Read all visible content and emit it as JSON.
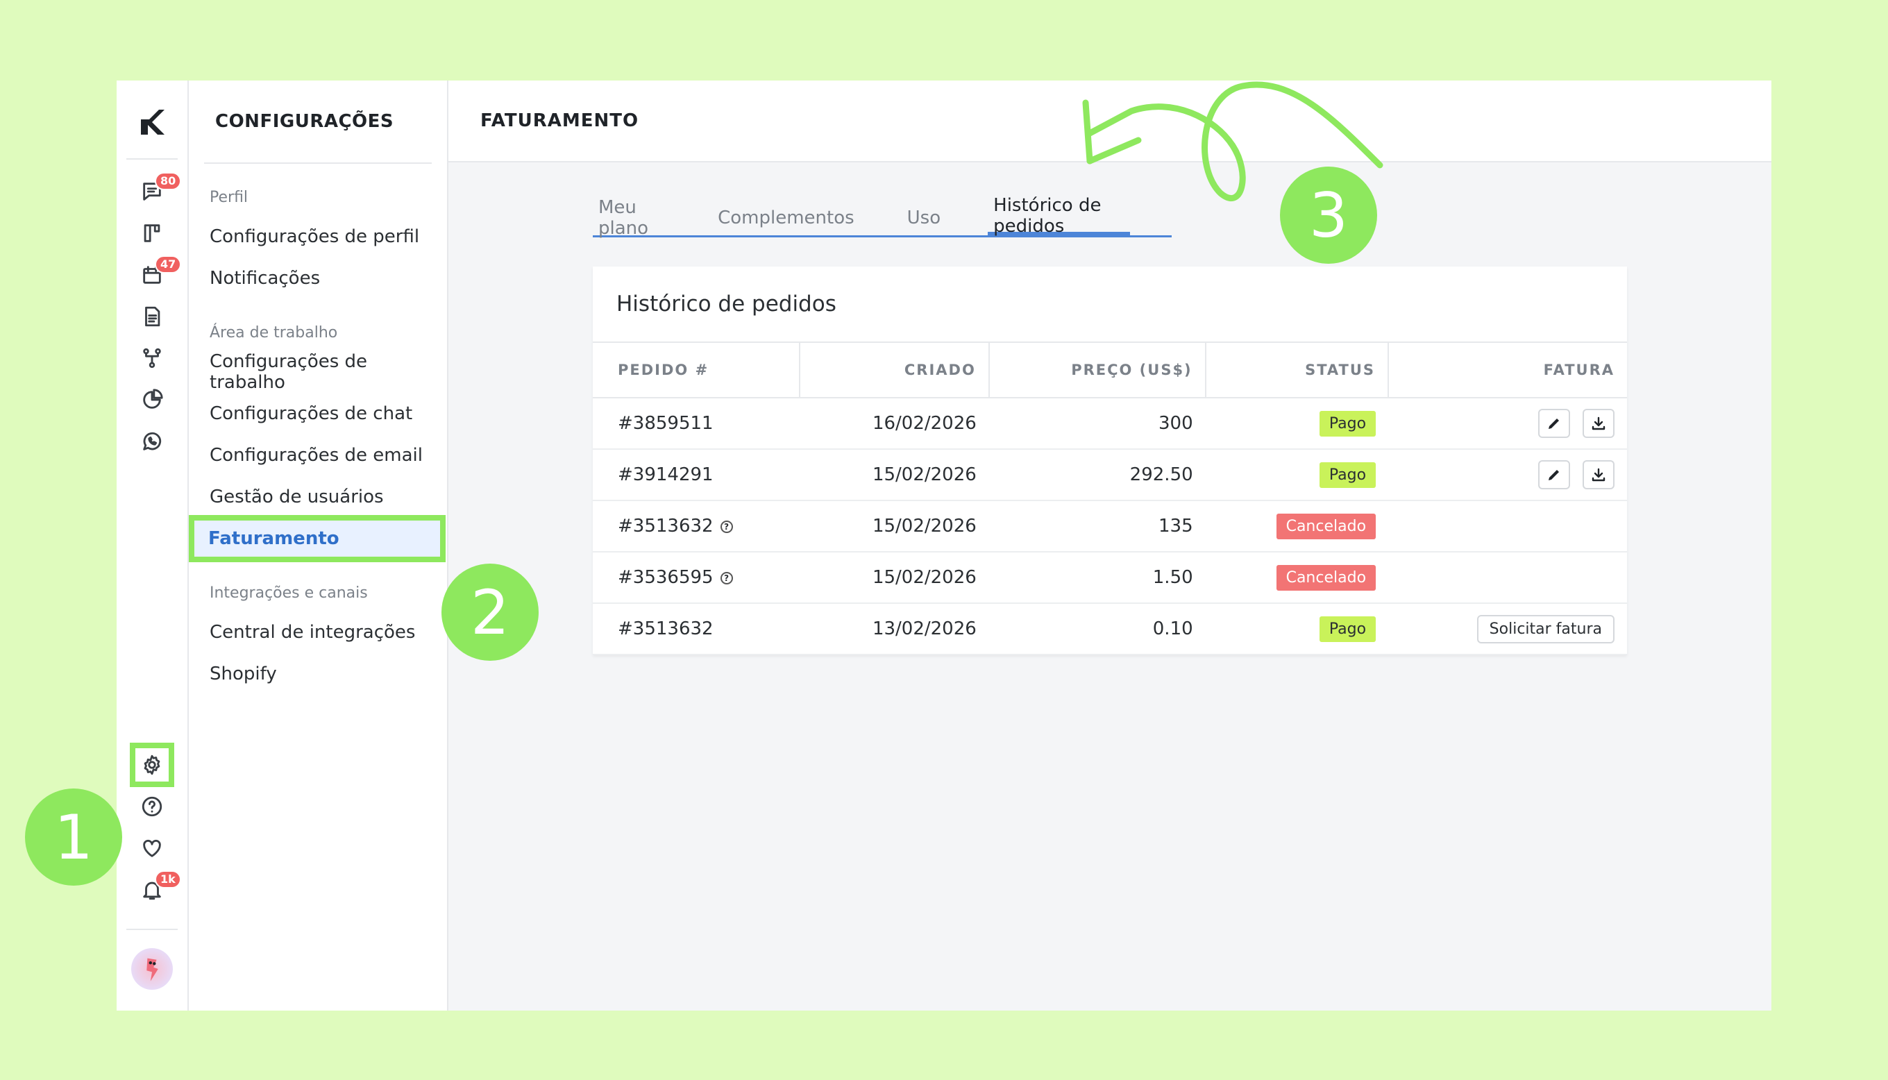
{
  "rail": {
    "badges": {
      "chat": "80",
      "calendar": "47",
      "notifications": "1k"
    }
  },
  "menu": {
    "title": "CONFIGURAÇÕES",
    "groups": [
      {
        "label": "Perfil",
        "items": [
          "Configurações de perfil",
          "Notificações"
        ]
      },
      {
        "label": "Área de trabalho",
        "items": [
          "Configurações de trabalho",
          "Configurações de chat",
          "Configurações de email",
          "Gestão de usuários",
          "Faturamento"
        ]
      },
      {
        "label": "Integrações e canais",
        "items": [
          "Central de integrações",
          "Shopify"
        ]
      }
    ]
  },
  "main": {
    "title": "FATURAMENTO",
    "tabs": [
      "Meu plano",
      "Complementos",
      "Uso",
      "Histórico de pedidos"
    ],
    "card_title": "Histórico de pedidos",
    "columns": [
      "PEDIDO #",
      "CRIADO",
      "PREÇO (US$)",
      "STATUS",
      "FATURA"
    ],
    "rows": [
      {
        "order": "#3859511",
        "created": "16/02/2026",
        "price": "300",
        "status": "Pago"
      },
      {
        "order": "#3914291",
        "created": "15/02/2026",
        "price": "292.50",
        "status": "Pago"
      },
      {
        "order": "#3513632",
        "created": "15/02/2026",
        "price": "135",
        "status": "Cancelado"
      },
      {
        "order": "#3536595",
        "created": "15/02/2026",
        "price": "1.50",
        "status": "Cancelado"
      },
      {
        "order": "#3513632",
        "created": "13/02/2026",
        "price": "0.10",
        "status": "Pago",
        "action": "Solicitar fatura"
      }
    ]
  },
  "steps": [
    "1",
    "2",
    "3"
  ],
  "colors": {
    "highlight": "#8ee85e",
    "accent": "#4d85d8",
    "paid": "#c9f25a",
    "cancelled": "#f27474"
  }
}
